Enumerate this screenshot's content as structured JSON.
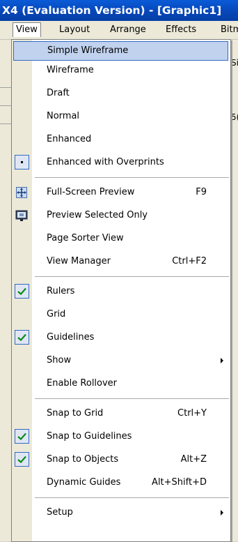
{
  "window": {
    "title": "X4 (Evaluation Version) - [Graphic1]"
  },
  "menubar": {
    "items": [
      {
        "label": "View",
        "key": "V"
      },
      {
        "label": "Layout",
        "key": "L"
      },
      {
        "label": "Arrange",
        "key": "A"
      },
      {
        "label": "Effects",
        "key": "C"
      },
      {
        "label": "Bitm"
      }
    ]
  },
  "view_menu": {
    "items": [
      {
        "label": "Simple Wireframe",
        "highlighted": true
      },
      {
        "label": "Wireframe"
      },
      {
        "label": "Draft"
      },
      {
        "label": "Normal"
      },
      {
        "label": "Enhanced"
      },
      {
        "label": "Enhanced with Overprints",
        "marker": "dot"
      },
      {
        "label": "Full-Screen Preview",
        "shortcut": "F9",
        "icon": "fullscreen-preview-icon"
      },
      {
        "label": "Preview Selected Only",
        "icon": "preview-selected-icon"
      },
      {
        "label": "Page Sorter View"
      },
      {
        "label": "View Manager",
        "shortcut": "Ctrl+F2"
      },
      {
        "label": "Rulers",
        "checked": true
      },
      {
        "label": "Grid"
      },
      {
        "label": "Guidelines",
        "checked": true
      },
      {
        "label": "Show",
        "submenu": true
      },
      {
        "label": "Enable Rollover"
      },
      {
        "label": "Snap to Grid",
        "shortcut": "Ctrl+Y"
      },
      {
        "label": "Snap to Guidelines",
        "checked": true
      },
      {
        "label": "Snap to Objects",
        "shortcut": "Alt+Z",
        "checked": true
      },
      {
        "label": "Dynamic Guides",
        "shortcut": "Alt+Shift+D"
      },
      {
        "label": "Setup",
        "submenu": true
      }
    ]
  },
  "background": {
    "right_fragments": [
      "Si",
      "5("
    ]
  }
}
